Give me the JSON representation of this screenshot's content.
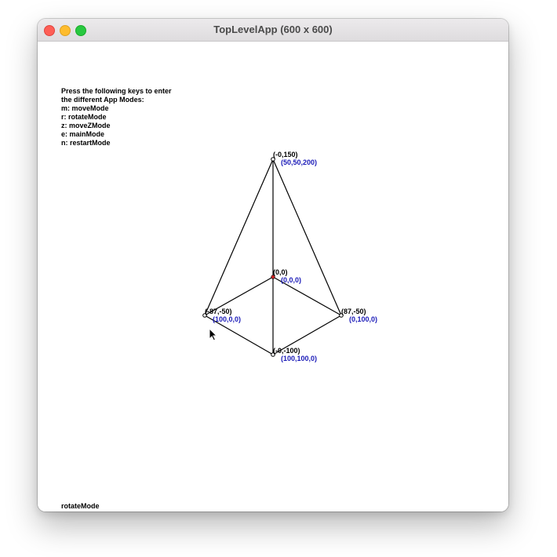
{
  "window": {
    "title": "TopLevelApp (600 x 600)"
  },
  "instructions": {
    "lines": [
      "Press the following keys to enter",
      "the different App Modes:",
      "m: moveMode",
      "r: rotateMode",
      "z: moveZMode",
      "e: mainMode",
      "n: restartMode"
    ]
  },
  "status": {
    "mode": "rotateMode"
  },
  "vertices": [
    {
      "id": "apex",
      "screen_label": "(-0,150)",
      "world_label": "(50,50,200)"
    },
    {
      "id": "origin",
      "screen_label": "(0,0)",
      "world_label": "(0,0,0)"
    },
    {
      "id": "left",
      "screen_label": "(-87,-50)",
      "world_label": "(100,0,0)"
    },
    {
      "id": "right",
      "screen_label": "(87,-50)",
      "world_label": "(0,100,0)"
    },
    {
      "id": "bottom",
      "screen_label": "(-0,-100)",
      "world_label": "(100,100,0)"
    }
  ],
  "colors": {
    "edge": "#000000",
    "vertex_fill": "#ffffff",
    "origin_vertex": "#cc2222",
    "world_label": "#1a1ab8"
  }
}
